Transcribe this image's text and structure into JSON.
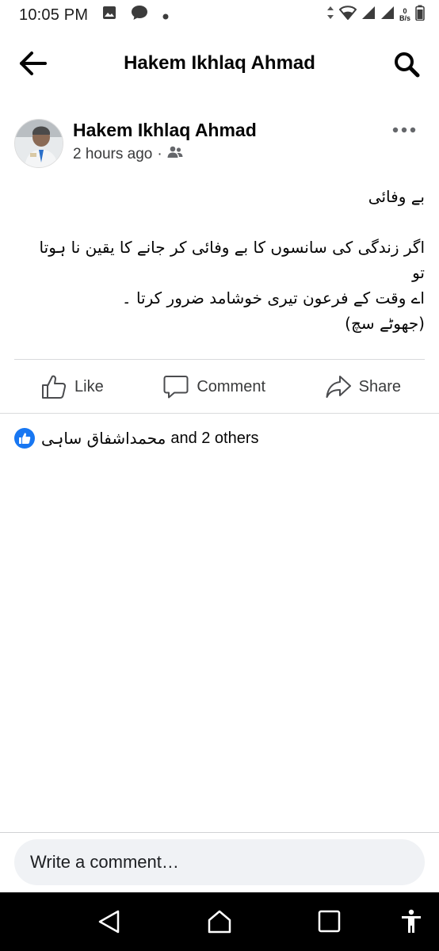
{
  "status_bar": {
    "time": "10:05 PM",
    "net_speed_value": "0",
    "net_speed_unit": "B/s"
  },
  "header": {
    "title": "Hakem Ikhlaq Ahmad"
  },
  "post": {
    "author": "Hakem Ikhlaq Ahmad",
    "time": "2 hours ago",
    "separator": "·",
    "privacy_icon": "friends-icon",
    "body_lines": [
      "بے وفائی",
      "",
      "اگر زندگی کی سانسوں کا بے وفائی کر جانے کا یقین نا ہوتا",
      "تو",
      "اے وقت کے فرعون تیری خوشامد ضرور کرتا ۔",
      "(جھوٹے سچ)"
    ]
  },
  "actions": {
    "like": "Like",
    "comment": "Comment",
    "share": "Share"
  },
  "reactions": {
    "name": "محمداشفاق ساہی",
    "others": "and 2 others"
  },
  "comment_box": {
    "placeholder": "Write a comment…"
  },
  "colors": {
    "accent": "#1877f2",
    "text": "#050505",
    "secondary_text": "#3a3b3c",
    "divider": "#d9dadc",
    "comment_bg": "#f0f2f5",
    "nav_bar": "#000000"
  }
}
